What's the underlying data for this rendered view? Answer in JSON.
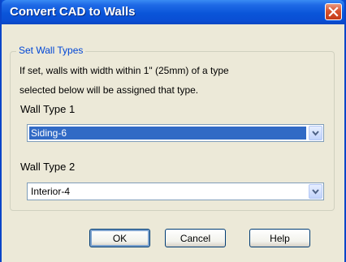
{
  "window": {
    "title": "Convert CAD to Walls"
  },
  "group": {
    "title": "Set Wall Types",
    "description_line1": "If set, walls with width within 1\" (25mm) of a type",
    "description_line2": "selected below will be assigned that type."
  },
  "wall_type_1": {
    "label": "Wall Type 1",
    "value": "Siding-6"
  },
  "wall_type_2": {
    "label": "Wall Type 2",
    "value": "Interior-4"
  },
  "buttons": {
    "ok": "OK",
    "cancel": "Cancel",
    "help": "Help"
  },
  "colors": {
    "titlebar": "#0a55d9",
    "selection": "#316ac5",
    "group_title": "#0046d5",
    "client_bg": "#ece9d8"
  },
  "icons": {
    "close": "close-icon",
    "dropdown": "chevron-down-icon"
  }
}
